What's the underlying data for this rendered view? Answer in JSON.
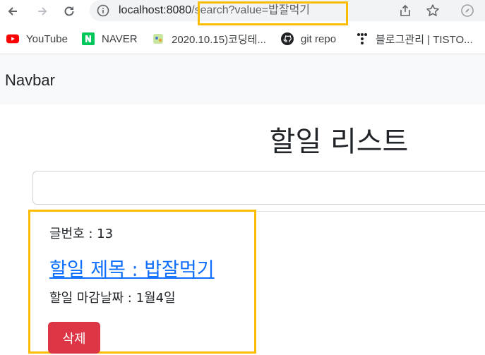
{
  "browser": {
    "url_host": "localhost:8080",
    "url_path": "/search?value=밥잘먹기",
    "bookmarks": [
      {
        "label": "YouTube",
        "icon": "youtube-icon"
      },
      {
        "label": "NAVER",
        "icon": "naver-icon"
      },
      {
        "label": "2020.10.15)코딩테...",
        "icon": "bookmark-favicon-icon"
      },
      {
        "label": "git repo",
        "icon": "github-icon"
      },
      {
        "label": "블로그관리 | TISTO...",
        "icon": "tistory-icon"
      }
    ],
    "colors": {
      "highlight": "#fbbc04",
      "youtube": "#ff0000",
      "naver": "#03c75a"
    }
  },
  "navbar": {
    "brand": "Navbar"
  },
  "main": {
    "title": "할일 리스트",
    "search": {
      "value": "",
      "placeholder": ""
    },
    "todos": [
      {
        "number_text": "글번호 : 13",
        "title_text": "할일 제목 : 밥잘먹기",
        "due_text": "할일 마감날짜 : 1월4일",
        "delete_label": "삭제"
      }
    ],
    "colors": {
      "link": "#0d6efd",
      "danger": "#dc3545"
    }
  }
}
